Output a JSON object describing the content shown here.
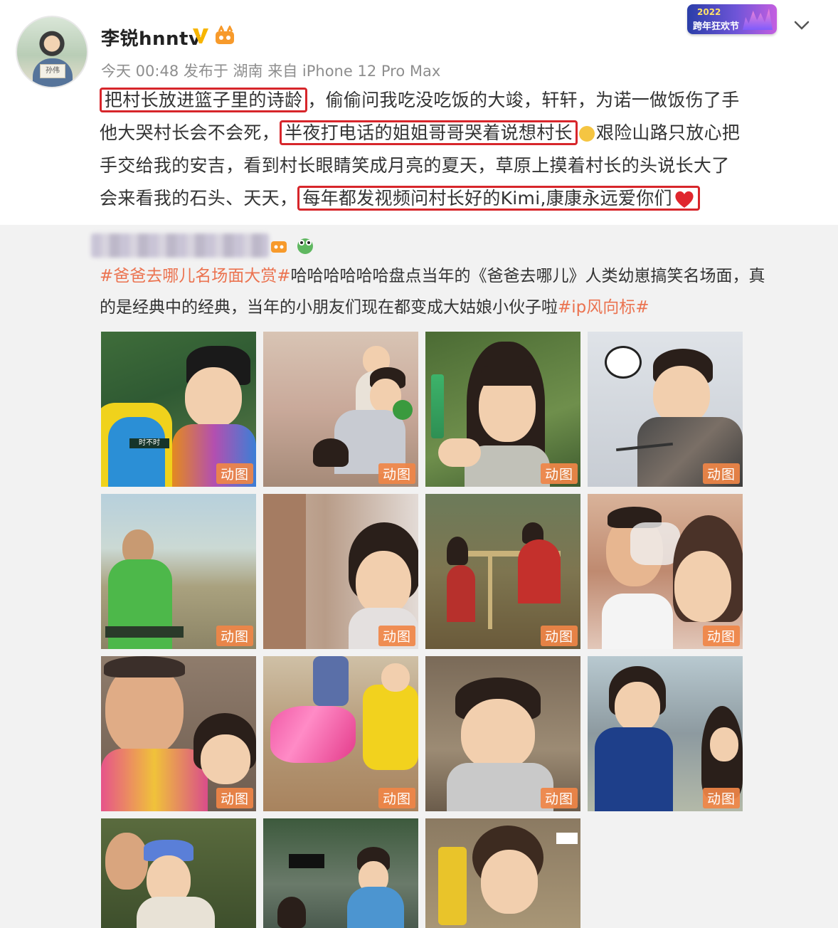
{
  "header": {
    "username": "李锐hnntv",
    "meta": "今天 00:48 发布于 湖南 来自 iPhone 12 Pro Max",
    "badge_line1": "2022",
    "badge_line2": "跨年狂欢节",
    "avatar_sign": "孙伟"
  },
  "post": {
    "lines": [
      [
        {
          "text": "把村长放进篮子里的诗龄",
          "highlight": true
        },
        {
          "text": "，偷偷问我吃没吃饭的大竣，轩轩，为诺一做饭伤了手",
          "highlight": false
        }
      ],
      [
        {
          "text": "他大哭村长会不会死，",
          "highlight": false
        },
        {
          "text": "半夜打电话的姐姐哥哥哭着说想村长",
          "highlight": true
        },
        {
          "text": "艰险山路只放心把",
          "highlight": false
        }
      ],
      [
        {
          "text": "手交给我的安吉，看到村长眼睛笑成月亮的夏天，草原上摸着村长的头说长大了",
          "highlight": false
        }
      ],
      [
        {
          "text": "会来看我的石头、天天，",
          "highlight": false
        },
        {
          "text": "每年都发视频问村长好的Kimi,康康永远爱你们",
          "highlight": true
        }
      ]
    ],
    "heart_color": "#e0262d",
    "highlight_color": "#d7262b"
  },
  "repost": {
    "hashtag1": "#爸爸去哪儿名场面大赏#",
    "text1": "哈哈哈哈哈哈盘点当年的《爸爸去哪儿》人类幼崽搞笑名场面，真",
    "text2": "的是经典中的经典，当年的小朋友们现在都变成大姑娘小伙子啦",
    "hashtag2": "#ip风向标#",
    "hashtag_color": "#eb7350",
    "gif_label": "动图",
    "tiles": [
      {
        "scene": "yellow-raincoat-crying"
      },
      {
        "scene": "kids-at-fence"
      },
      {
        "scene": "girl-bangs-closeup"
      },
      {
        "scene": "boy-eating-chopsticks"
      },
      {
        "scene": "boy-green-shirt-hills"
      },
      {
        "scene": "girl-doorway"
      },
      {
        "scene": "kids-field-frame"
      },
      {
        "scene": "man-drinking-girl"
      },
      {
        "scene": "father-pink-jacket"
      },
      {
        "scene": "pink-bag-floor"
      },
      {
        "scene": "child-frowning"
      },
      {
        "scene": "girl-navy-dress"
      },
      {
        "scene": "father-child-cap"
      },
      {
        "scene": "boy-blue-vest"
      },
      {
        "scene": "curly-hair-pout"
      }
    ],
    "tile_texts": [
      "时不时",
      "",
      "",
      "",
      "",
      "",
      "",
      "",
      "",
      "",
      "",
      "",
      "",
      "",
      ""
    ]
  }
}
